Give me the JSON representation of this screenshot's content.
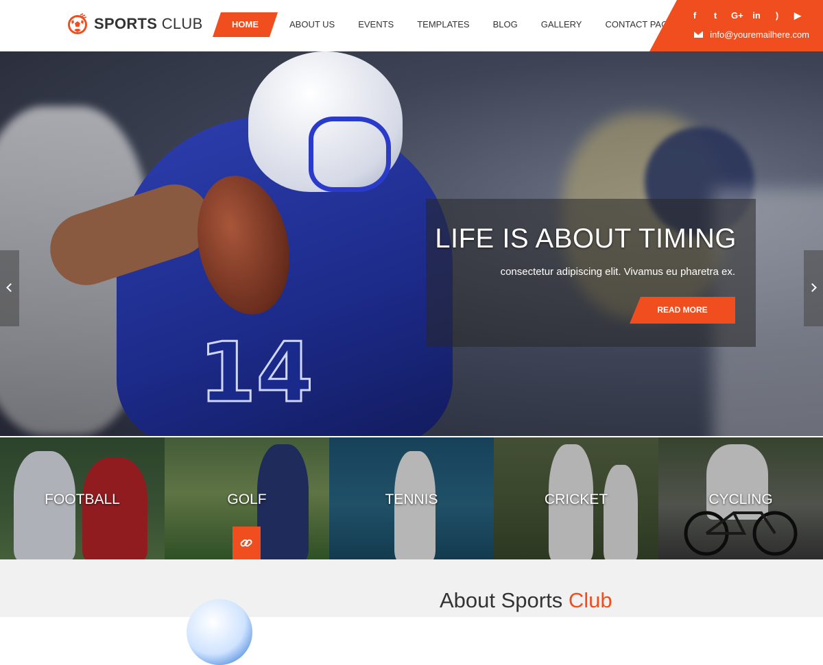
{
  "logo": {
    "brand_bold": "SPORTS",
    "brand_light": "CLUB"
  },
  "nav": {
    "items": [
      {
        "label": "HOME",
        "active": true
      },
      {
        "label": "ABOUT US"
      },
      {
        "label": "EVENTS"
      },
      {
        "label": "TEMPLATES"
      },
      {
        "label": "BLOG"
      },
      {
        "label": "GALLERY"
      },
      {
        "label": "CONTACT PAGE"
      }
    ]
  },
  "topbar": {
    "socials": [
      {
        "glyph": "f",
        "icon": "facebook-icon"
      },
      {
        "glyph": "t",
        "icon": "twitter-icon"
      },
      {
        "glyph": "G+",
        "icon": "google-plus-icon"
      },
      {
        "glyph": "in",
        "icon": "linkedin-icon"
      },
      {
        "glyph": ")",
        "icon": "rss-icon"
      },
      {
        "glyph": "▶",
        "icon": "youtube-icon"
      }
    ],
    "email": "info@youremailhere.com"
  },
  "hero": {
    "title": "LIFE IS ABOUT TIMING",
    "subtitle": "consectetur adipiscing elit. Vivamus eu pharetra ex.",
    "cta": "READ MORE",
    "jersey_number": "14"
  },
  "categories": [
    {
      "label": "FOOTBALL"
    },
    {
      "label": "GOLF"
    },
    {
      "label": "TENNIS"
    },
    {
      "label": "CRICKET"
    },
    {
      "label": "CYCLING"
    }
  ],
  "about": {
    "title_main": "About Sports",
    "title_accent": "Club"
  },
  "colors": {
    "accent": "#f04e1f",
    "text": "#333333",
    "about_bg": "#f1f1f1"
  }
}
